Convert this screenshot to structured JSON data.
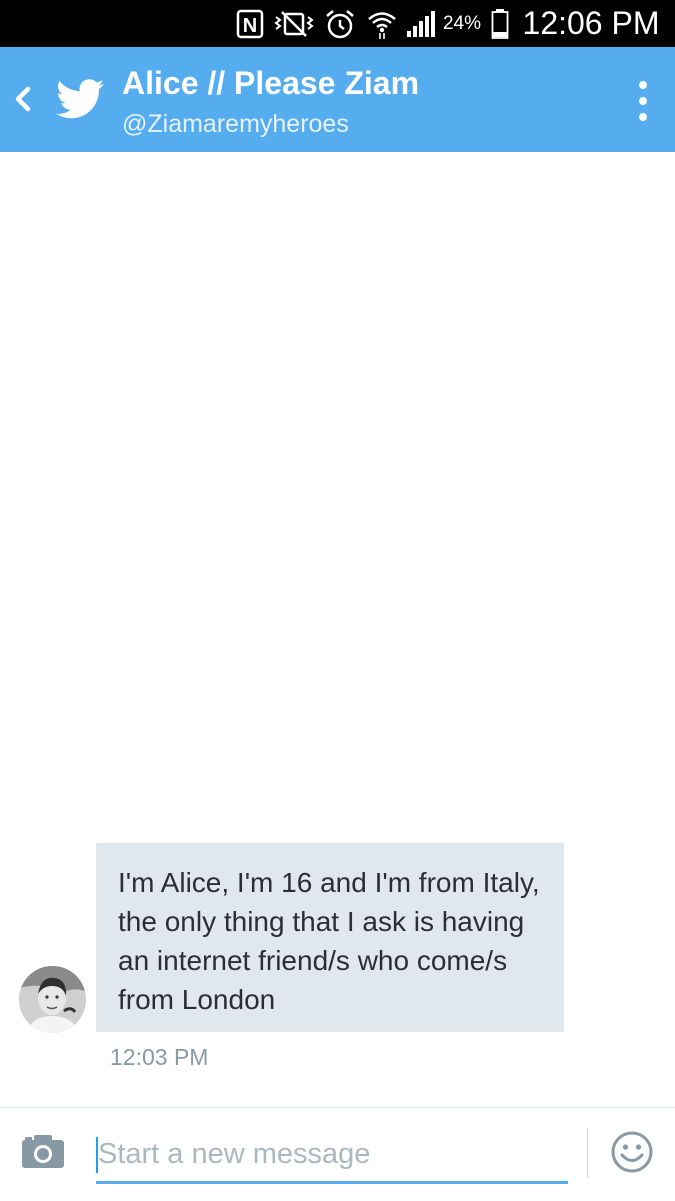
{
  "status_bar": {
    "battery_percent": "24%",
    "time": "12:06 PM",
    "icons": [
      "nfc-icon",
      "vibrate-icon",
      "alarm-icon",
      "wifi-icon",
      "signal-icon",
      "battery-icon"
    ]
  },
  "header": {
    "title": "Alice // Please Ziam",
    "handle": "@Ziamaremyheroes",
    "back_icon": "chevron-left-icon",
    "logo_icon": "twitter-bird-icon",
    "menu_icon": "more-vertical-icon",
    "background_color": "#55acee"
  },
  "conversation": {
    "messages": [
      {
        "text": "I'm Alice, I'm 16 and I'm from Italy, the only thing that I ask is having an internet friend/s who come/s from London",
        "timestamp": "12:03 PM",
        "direction": "incoming"
      }
    ],
    "bubble_color": "#e1e8ed"
  },
  "composer": {
    "placeholder": "Start a new message",
    "value": "",
    "camera_icon": "camera-icon",
    "emoji_icon": "emoji-icon",
    "accent_color": "#55acee"
  }
}
